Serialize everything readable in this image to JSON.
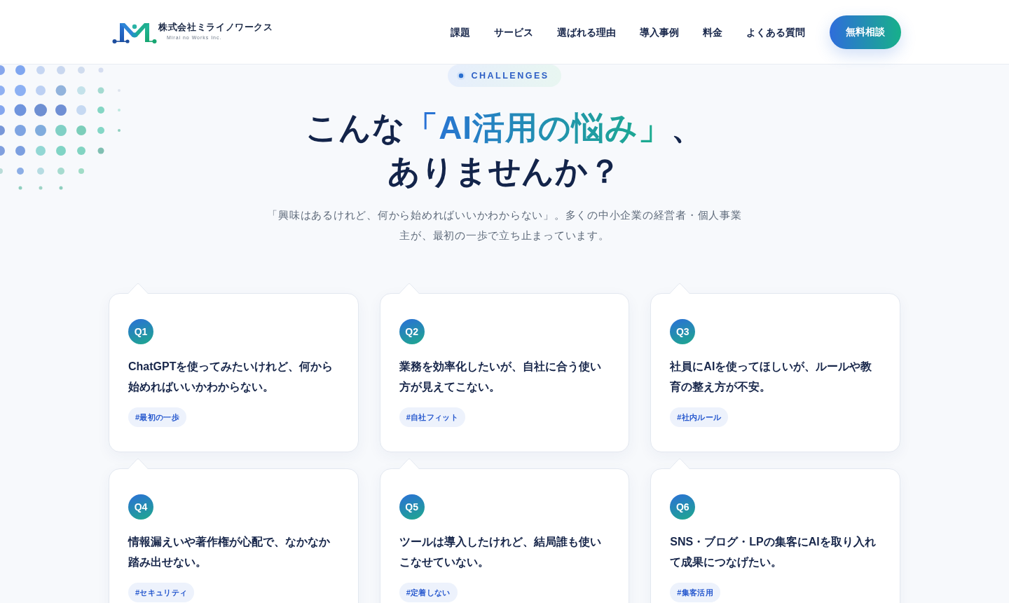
{
  "header": {
    "logo": {
      "name": "株式会社ミライノワークス",
      "tagline": "Mirai no Works Inc."
    },
    "nav": [
      "課題",
      "サービス",
      "選ばれる理由",
      "導入事例",
      "料金",
      "よくある質問"
    ],
    "cta": "無料相談"
  },
  "section": {
    "badge": "CHALLENGES",
    "title": {
      "lead": "こんな",
      "highlight": "「AI活用の悩み」",
      "tail": "、",
      "line2": "ありませんか？"
    },
    "description": "「興味はあるけれど、何から始めればいいかわからない」。多くの中小企業の経営者・個人事業主が、最初の一歩で立ち止まっています。"
  },
  "cards": [
    {
      "number": "Q1",
      "question": "ChatGPTを使ってみたいけれど、何から始めればいいかわからない。",
      "tag": "#最初の一歩"
    },
    {
      "number": "Q2",
      "question": "業務を効率化したいが、自社に合う使い方が見えてこない。",
      "tag": "#自社フィット"
    },
    {
      "number": "Q3",
      "question": "社員にAIを使ってほしいが、ルールや教育の整え方が不安。",
      "tag": "#社内ルール"
    },
    {
      "number": "Q4",
      "question": "情報漏えいや著作権が心配で、なかなか踏み出せない。",
      "tag": "#セキュリティ"
    },
    {
      "number": "Q5",
      "question": "ツールは導入したけれど、結局誰も使いこなせていない。",
      "tag": "#定着しない"
    },
    {
      "number": "Q6",
      "question": "SNS・ブログ・LPの集客にAIを取り入れて成果につなげたい。",
      "tag": "#集客活用"
    }
  ]
}
